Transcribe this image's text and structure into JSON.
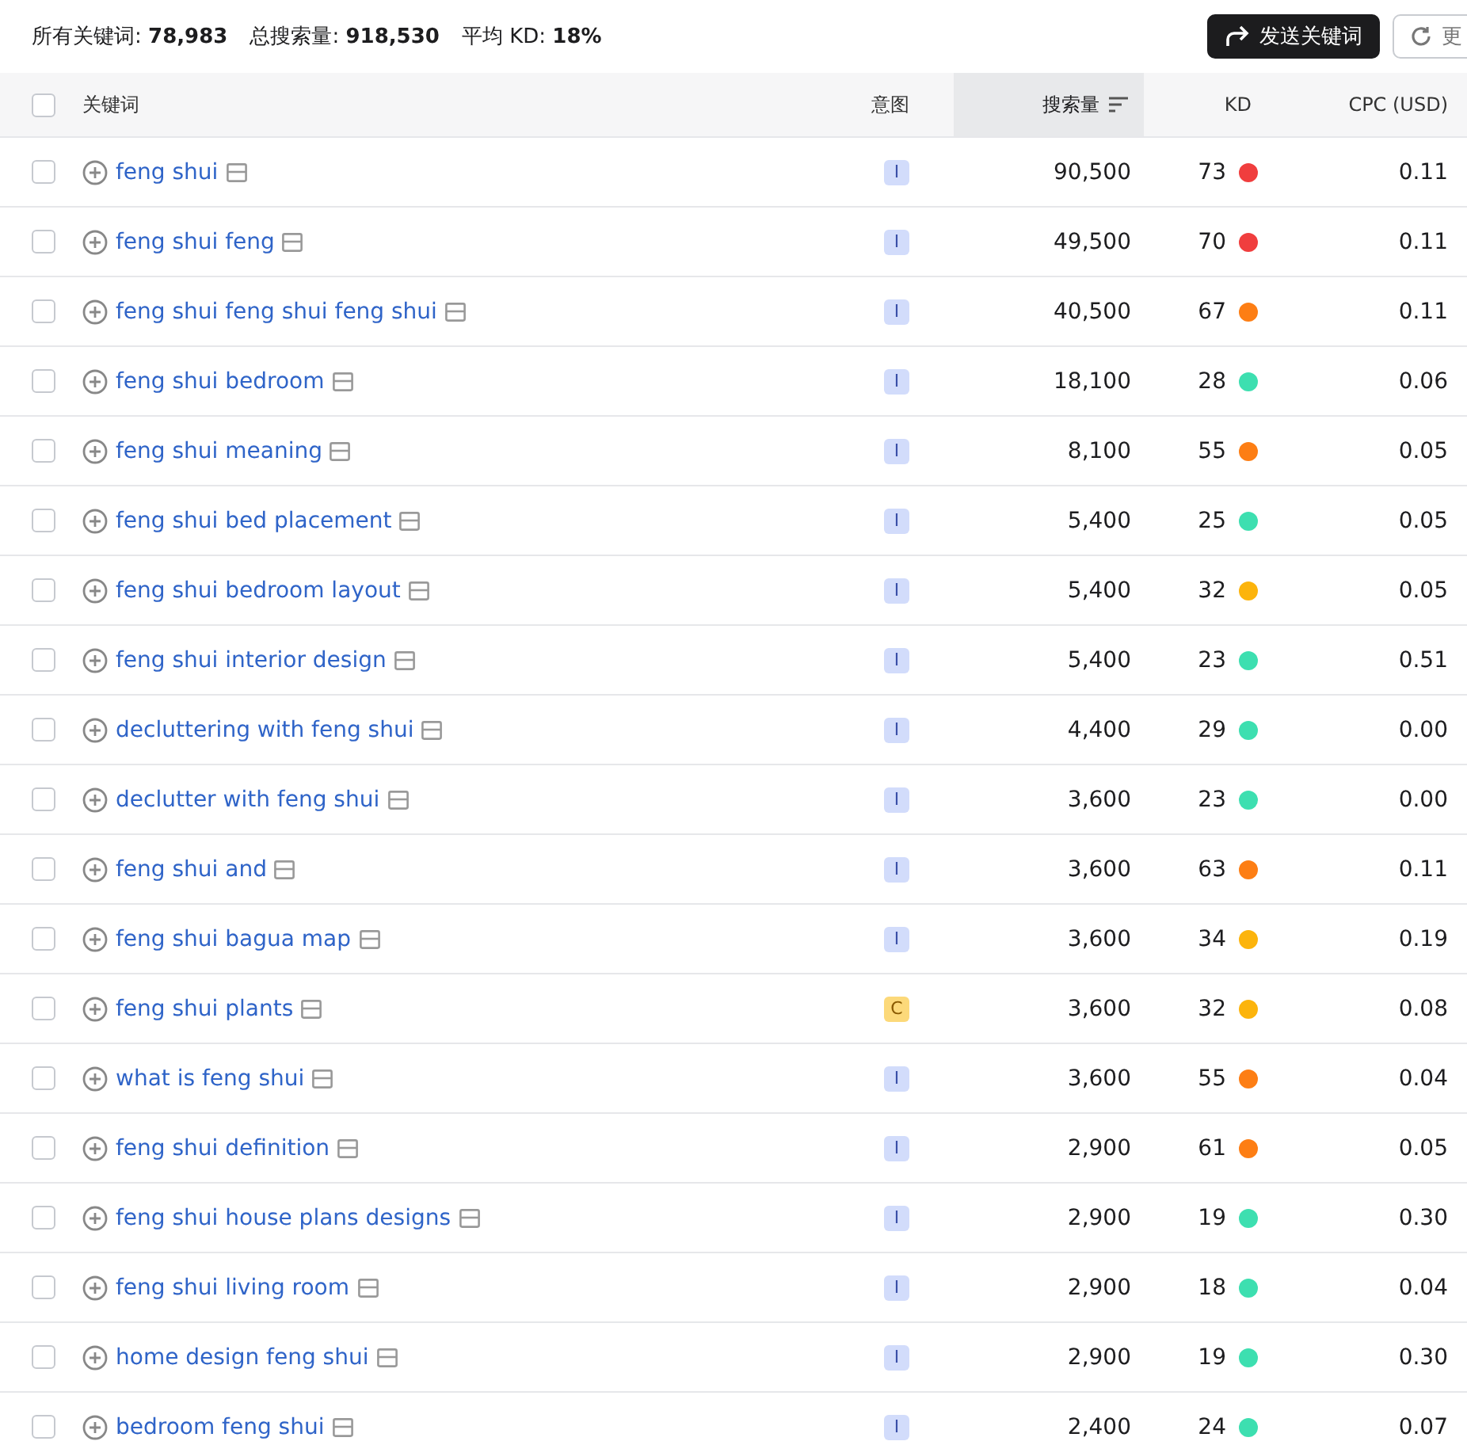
{
  "summary": [
    {
      "label": "所有关键词:",
      "value": "78,983"
    },
    {
      "label": "总搜索量:",
      "value": "918,530"
    },
    {
      "label": "平均 KD:",
      "value": "18%"
    }
  ],
  "actions": [
    {
      "label": "发送关键词",
      "kind": "send"
    },
    {
      "label": "更",
      "kind": "refresh"
    }
  ],
  "table": {
    "select_all": {
      "checked": false
    },
    "columns": [
      {
        "label": "关键词",
        "sorted": false
      },
      {
        "label": "意图",
        "sorted": false
      },
      {
        "label": "搜索量",
        "sorted": true
      },
      {
        "label": "KD",
        "sorted": false
      },
      {
        "label": "CPC (USD)",
        "sorted": false
      }
    ],
    "rows": [
      {
        "checked": false,
        "keyword": "feng shui",
        "intent": {
          "label": "I",
          "kind": "informational"
        },
        "volume": "90,500",
        "kd": "73",
        "color": "#f03e3e",
        "cpc": "0.11"
      },
      {
        "checked": false,
        "keyword": "feng shui feng",
        "intent": {
          "label": "I",
          "kind": "informational"
        },
        "volume": "49,500",
        "kd": "70",
        "color": "#f03e3e",
        "cpc": "0.11"
      },
      {
        "checked": false,
        "keyword": "feng shui feng shui feng shui",
        "intent": {
          "label": "I",
          "kind": "informational"
        },
        "volume": "40,500",
        "kd": "67",
        "color": "#fd7e14",
        "cpc": "0.11"
      },
      {
        "checked": false,
        "keyword": "feng shui bedroom",
        "intent": {
          "label": "I",
          "kind": "informational"
        },
        "volume": "18,100",
        "kd": "28",
        "color": "#3ddfb0",
        "cpc": "0.06"
      },
      {
        "checked": false,
        "keyword": "feng shui meaning",
        "intent": {
          "label": "I",
          "kind": "informational"
        },
        "volume": "8,100",
        "kd": "55",
        "color": "#fd7e14",
        "cpc": "0.05"
      },
      {
        "checked": false,
        "keyword": "feng shui bed placement",
        "intent": {
          "label": "I",
          "kind": "informational"
        },
        "volume": "5,400",
        "kd": "25",
        "color": "#3ddfb0",
        "cpc": "0.05"
      },
      {
        "checked": false,
        "keyword": "feng shui bedroom layout",
        "intent": {
          "label": "I",
          "kind": "informational"
        },
        "volume": "5,400",
        "kd": "32",
        "color": "#fcb40c",
        "cpc": "0.05"
      },
      {
        "checked": false,
        "keyword": "feng shui interior design",
        "intent": {
          "label": "I",
          "kind": "informational"
        },
        "volume": "5,400",
        "kd": "23",
        "color": "#3ddfb0",
        "cpc": "0.51"
      },
      {
        "checked": false,
        "keyword": "decluttering with feng shui",
        "intent": {
          "label": "I",
          "kind": "informational"
        },
        "volume": "4,400",
        "kd": "29",
        "color": "#3ddfb0",
        "cpc": "0.00"
      },
      {
        "checked": false,
        "keyword": "declutter with feng shui",
        "intent": {
          "label": "I",
          "kind": "informational"
        },
        "volume": "3,600",
        "kd": "23",
        "color": "#3ddfb0",
        "cpc": "0.00"
      },
      {
        "checked": false,
        "keyword": "feng shui and",
        "intent": {
          "label": "I",
          "kind": "informational"
        },
        "volume": "3,600",
        "kd": "63",
        "color": "#fd7e14",
        "cpc": "0.11"
      },
      {
        "checked": false,
        "keyword": "feng shui bagua map",
        "intent": {
          "label": "I",
          "kind": "informational"
        },
        "volume": "3,600",
        "kd": "34",
        "color": "#fcb40c",
        "cpc": "0.19"
      },
      {
        "checked": false,
        "keyword": "feng shui plants",
        "intent": {
          "label": "C",
          "kind": "commercial"
        },
        "volume": "3,600",
        "kd": "32",
        "color": "#fcb40c",
        "cpc": "0.08"
      },
      {
        "checked": false,
        "keyword": "what is feng shui",
        "intent": {
          "label": "I",
          "kind": "informational"
        },
        "volume": "3,600",
        "kd": "55",
        "color": "#fd7e14",
        "cpc": "0.04"
      },
      {
        "checked": false,
        "keyword": "feng shui definition",
        "intent": {
          "label": "I",
          "kind": "informational"
        },
        "volume": "2,900",
        "kd": "61",
        "color": "#fd7e14",
        "cpc": "0.05"
      },
      {
        "checked": false,
        "keyword": "feng shui house plans designs",
        "intent": {
          "label": "I",
          "kind": "informational"
        },
        "volume": "2,900",
        "kd": "19",
        "color": "#3ddfb0",
        "cpc": "0.30"
      },
      {
        "checked": false,
        "keyword": "feng shui living room",
        "intent": {
          "label": "I",
          "kind": "informational"
        },
        "volume": "2,900",
        "kd": "18",
        "color": "#3ddfb0",
        "cpc": "0.04"
      },
      {
        "checked": false,
        "keyword": "home design feng shui",
        "intent": {
          "label": "I",
          "kind": "informational"
        },
        "volume": "2,900",
        "kd": "19",
        "color": "#3ddfb0",
        "cpc": "0.30"
      },
      {
        "checked": false,
        "keyword": "bedroom feng shui",
        "intent": {
          "label": "I",
          "kind": "informational"
        },
        "volume": "2,400",
        "kd": "24",
        "color": "#3ddfb0",
        "cpc": "0.07"
      }
    ]
  }
}
